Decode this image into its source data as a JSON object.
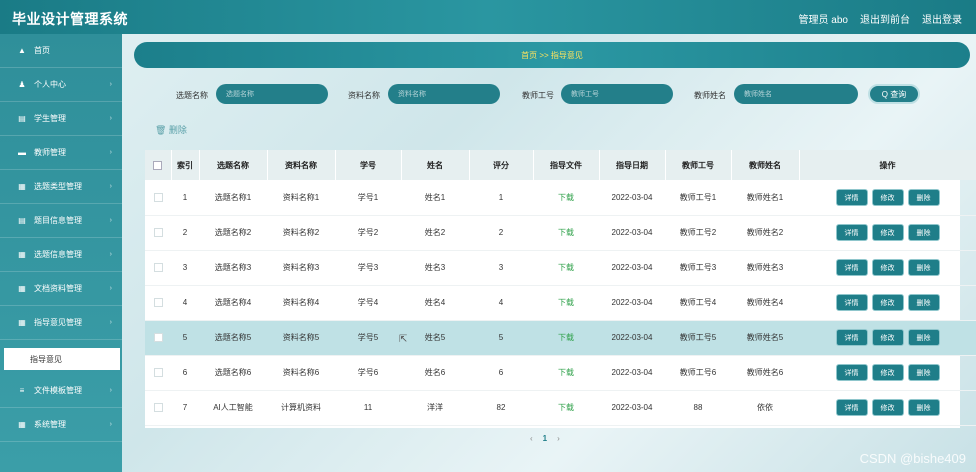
{
  "app_title": "毕业设计管理系统",
  "header": {
    "user": "管理员 abo",
    "back_to_front": "退出到前台",
    "logout": "退出登录"
  },
  "sidebar": {
    "items": [
      {
        "icon": "home-icon",
        "glyph": "▲",
        "label": "首页"
      },
      {
        "icon": "user-icon",
        "glyph": "♟",
        "label": "个人中心"
      },
      {
        "icon": "doc-icon",
        "glyph": "▤",
        "label": "学生管理"
      },
      {
        "icon": "teacher-icon",
        "glyph": "▬",
        "label": "教师管理"
      },
      {
        "icon": "grid-icon",
        "glyph": "▦",
        "label": "选题类型管理"
      },
      {
        "icon": "list-icon",
        "glyph": "▤",
        "label": "题目信息管理"
      },
      {
        "icon": "grid-icon",
        "glyph": "▦",
        "label": "选题信息管理"
      },
      {
        "icon": "grid-icon",
        "glyph": "▦",
        "label": "文档资料管理"
      },
      {
        "icon": "grid-icon",
        "glyph": "▦",
        "label": "指导意见管理"
      },
      {
        "icon": "menu-icon",
        "glyph": "≡",
        "label": "文件模板管理"
      },
      {
        "icon": "grid-icon",
        "glyph": "▦",
        "label": "系统管理"
      }
    ],
    "sub_item": "指导意见"
  },
  "breadcrumb": "首页  >>  指导意见",
  "search": {
    "topic_label": "选题名称",
    "topic_placeholder": "选题名称",
    "material_label": "资料名称",
    "material_placeholder": "资料名称",
    "teacher_no_label": "教师工号",
    "teacher_no_placeholder": "教师工号",
    "teacher_name_label": "教师姓名",
    "teacher_name_placeholder": "教师姓名",
    "query_label": "Q 查询"
  },
  "delete_label": "🗑 删除",
  "table": {
    "headers": [
      "索引",
      "选题名称",
      "资料名称",
      "学号",
      "姓名",
      "评分",
      "指导文件",
      "指导日期",
      "教师工号",
      "教师姓名",
      "操作"
    ],
    "rows": [
      {
        "idx": "1",
        "topic": "选题名称1",
        "material": "资料名称1",
        "sno": "学号1",
        "name": "姓名1",
        "score": "1",
        "file": "下载",
        "date": "2022-03-04",
        "tno": "教师工号1",
        "tname": "教师姓名1"
      },
      {
        "idx": "2",
        "topic": "选题名称2",
        "material": "资料名称2",
        "sno": "学号2",
        "name": "姓名2",
        "score": "2",
        "file": "下载",
        "date": "2022-03-04",
        "tno": "教师工号2",
        "tname": "教师姓名2"
      },
      {
        "idx": "3",
        "topic": "选题名称3",
        "material": "资料名称3",
        "sno": "学号3",
        "name": "姓名3",
        "score": "3",
        "file": "下载",
        "date": "2022-03-04",
        "tno": "教师工号3",
        "tname": "教师姓名3"
      },
      {
        "idx": "4",
        "topic": "选题名称4",
        "material": "资料名称4",
        "sno": "学号4",
        "name": "姓名4",
        "score": "4",
        "file": "下载",
        "date": "2022-03-04",
        "tno": "教师工号4",
        "tname": "教师姓名4"
      },
      {
        "idx": "5",
        "topic": "选题名称5",
        "material": "资料名称5",
        "sno": "学号5",
        "name": "姓名5",
        "score": "5",
        "file": "下载",
        "date": "2022-03-04",
        "tno": "教师工号5",
        "tname": "教师姓名5"
      },
      {
        "idx": "6",
        "topic": "选题名称6",
        "material": "资料名称6",
        "sno": "学号6",
        "name": "姓名6",
        "score": "6",
        "file": "下载",
        "date": "2022-03-04",
        "tno": "教师工号6",
        "tname": "教师姓名6"
      },
      {
        "idx": "7",
        "topic": "AI人工智能",
        "material": "计算机资料",
        "sno": "11",
        "name": "洋洋",
        "score": "82",
        "file": "下载",
        "date": "2022-03-04",
        "tno": "88",
        "tname": "依依"
      }
    ],
    "actions": {
      "detail": "详情",
      "edit": "修改",
      "delete": "删除"
    }
  },
  "pagination": {
    "prev": "‹",
    "current": "1",
    "next": "›"
  },
  "watermark": "CSDN @bishe409",
  "colors": {
    "primary": "#1f7e89",
    "download": "#2fa14a",
    "breadcrumb_text": "#ffe45c"
  }
}
